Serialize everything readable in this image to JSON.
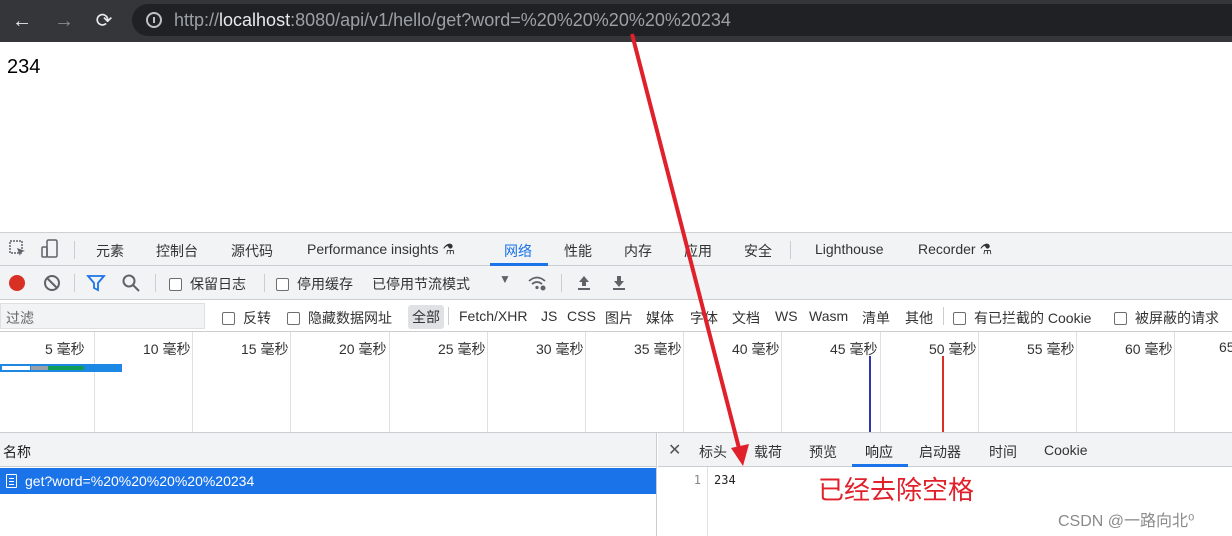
{
  "browser": {
    "url_host_prefix": "http://",
    "url_host": "localhost",
    "url_rest": ":8080/api/v1/hello/get?word=%20%20%20%20%20234"
  },
  "page": {
    "body_text": "234"
  },
  "devtools": {
    "tabs": [
      "元素",
      "控制台",
      "源代码",
      "Performance insights ⚗",
      "网络",
      "性能",
      "内存",
      "应用",
      "安全",
      "Lighthouse",
      "Recorder ⚗"
    ],
    "active_tab": "网络",
    "toolbar": {
      "preserve_log": "保留日志",
      "disable_cache": "停用缓存",
      "throttle": "已停用节流模式"
    },
    "filter": {
      "placeholder": "过滤",
      "invert": "反转",
      "hide_data_urls": "隐藏数据网址",
      "types": [
        "全部",
        "Fetch/XHR",
        "JS",
        "CSS",
        "图片",
        "媒体",
        "字体",
        "文档",
        "WS",
        "Wasm",
        "清单",
        "其他"
      ],
      "selected_type": "全部",
      "blocked_cookies": "有已拦截的 Cookie",
      "blocked_requests": "被屏蔽的请求"
    },
    "timeline_ticks": [
      "5 毫秒",
      "10 毫秒",
      "15 毫秒",
      "20 毫秒",
      "25 毫秒",
      "30 毫秒",
      "35 毫秒",
      "40 毫秒",
      "45 毫秒",
      "50 毫秒",
      "55 毫秒",
      "60 毫秒",
      "65"
    ],
    "list": {
      "header": "名称",
      "rows": [
        "get?word=%20%20%20%20%20234"
      ]
    },
    "detail": {
      "tabs": [
        "标头",
        "载荷",
        "预览",
        "响应",
        "启动器",
        "时间",
        "Cookie"
      ],
      "active_tab": "响应",
      "line_number": "1",
      "response_text": "234"
    }
  },
  "annotation": {
    "text": "已经去除空格",
    "color": "#e0202a"
  },
  "watermark": "CSDN @一路向北⁰",
  "colors": {
    "accent": "#1a73e8",
    "record": "#d93025"
  }
}
